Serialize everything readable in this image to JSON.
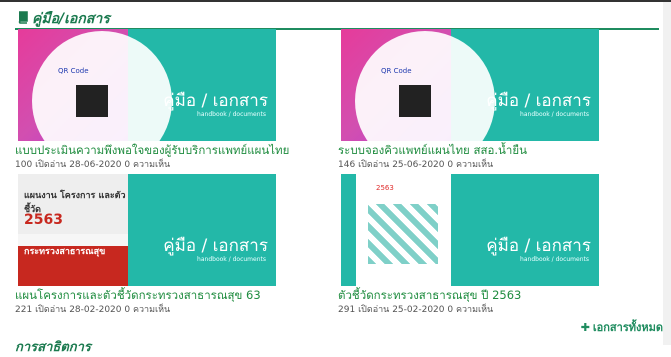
{
  "section": {
    "title": "คู่มือ/เอกสาร",
    "icon": "book-icon",
    "accent": "#1f8c5f"
  },
  "thumb_text": {
    "title": "คู่มือ / เอกสาร",
    "subtitle": "handbook / documents",
    "qr_label": "QR Code"
  },
  "cards": [
    {
      "caption": "แบบประเมินความพึงพอใจของผู้รับบริการแพทย์แผนไทย",
      "views": "100",
      "views_label": "เปิดอ่าน",
      "date": "28-06-2020",
      "comments": "0",
      "comments_label": "ความเห็น"
    },
    {
      "caption": "ระบบจองคิวแพทย์แผนไทย สสอ.น้ำยืน",
      "views": "146",
      "views_label": "เปิดอ่าน",
      "date": "25-06-2020",
      "comments": "0",
      "comments_label": "ความเห็น"
    },
    {
      "caption": "แผนโครงการและตัวชี้วัดกระทรวงสาธารณสุข 63",
      "views": "221",
      "views_label": "เปิดอ่าน",
      "date": "28-02-2020",
      "comments": "0",
      "comments_label": "ความเห็น",
      "cover_line1": "แผนงาน โครงการ และตัวชี้วัด",
      "cover_year": "2563",
      "cover_line2": "กระทรวงสาธารณสุข"
    },
    {
      "caption": "ตัวชี้วัดกระทรวงสาธารณสุข ปี 2563",
      "views": "291",
      "views_label": "เปิดอ่าน",
      "date": "25-02-2020",
      "comments": "0",
      "comments_label": "ความเห็น",
      "cover_year": "2563"
    }
  ],
  "all_link": "เอกสารทั้งหมด",
  "next_section": {
    "title": "การสาธิตการ"
  }
}
